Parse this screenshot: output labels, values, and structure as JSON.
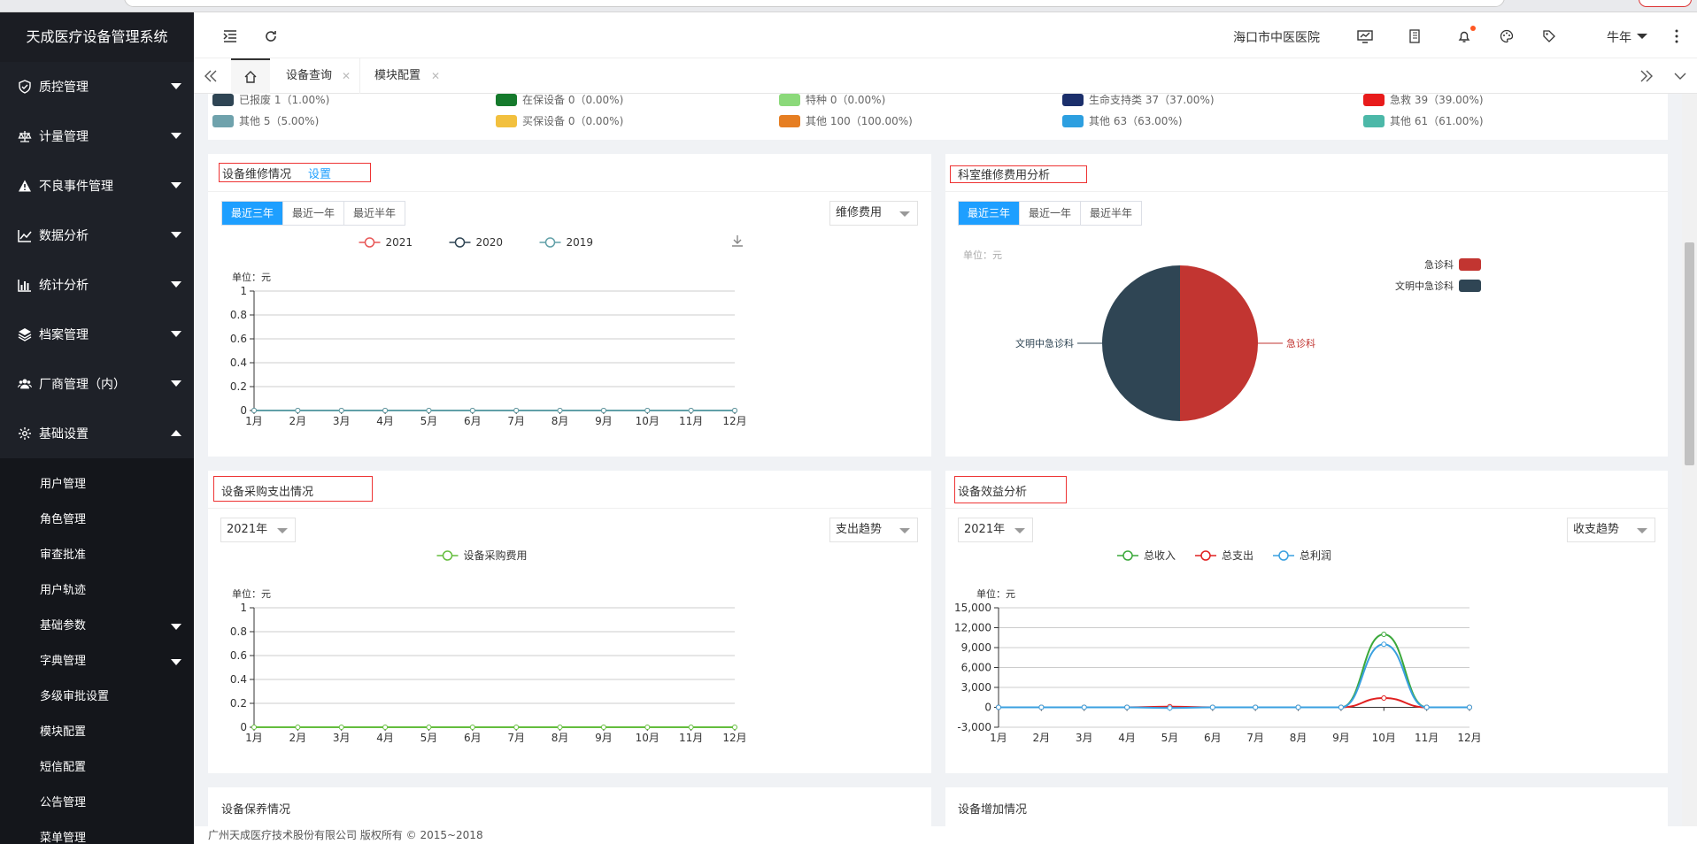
{
  "app": {
    "title": "天成医疗设备管理系统"
  },
  "sidebar": {
    "items": [
      {
        "label": "质控管理",
        "icon": "shield-check-icon"
      },
      {
        "label": "计量管理",
        "icon": "scale-icon"
      },
      {
        "label": "不良事件管理",
        "icon": "warning-icon"
      },
      {
        "label": "数据分析",
        "icon": "line-chart-icon"
      },
      {
        "label": "统计分析",
        "icon": "bar-chart-icon"
      },
      {
        "label": "档案管理",
        "icon": "layers-icon"
      },
      {
        "label": "厂商管理（内）",
        "icon": "users-icon"
      },
      {
        "label": "基础设置",
        "icon": "gear-icon"
      }
    ],
    "subitems": [
      "用户管理",
      "角色管理",
      "审查批准",
      "用户轨迹",
      "基础参数",
      "字典管理",
      "多级审批设置",
      "模块配置",
      "短信配置",
      "公告管理",
      "菜单管理"
    ]
  },
  "header": {
    "hospital": "海口市中医医院",
    "user": "牛年"
  },
  "tabs": {
    "items": [
      "设备查询",
      "模块配置"
    ]
  },
  "legend_strip": {
    "row1": [
      {
        "label": "已报废 1（1.00%)",
        "color": "#2f4554"
      },
      {
        "label": "在保设备 0（0.00%)",
        "color": "#157a2c"
      },
      {
        "label": "特种 0（0.00%)",
        "color": "#8bd97a"
      },
      {
        "label": "生命支持类 37（37.00%)",
        "color": "#1b2f6b"
      },
      {
        "label": "急救 39（39.00%)",
        "color": "#e81b1b"
      }
    ],
    "row2": [
      {
        "label": "其他 5（5.00%)",
        "color": "#6fa2ac"
      },
      {
        "label": "买保设备 0（0.00%)",
        "color": "#f2c03e"
      },
      {
        "label": "其他 100（100.00%)",
        "color": "#e67e22"
      },
      {
        "label": "其他 63（63.00%)",
        "color": "#2d9fe0"
      },
      {
        "label": "其他 61（61.00%)",
        "color": "#4cb8a8"
      }
    ]
  },
  "repair": {
    "title": "设备维修情况",
    "link": "设置",
    "segments": [
      "最近三年",
      "最近一年",
      "最近半年"
    ],
    "select": "维修费用",
    "unit": "单位：元"
  },
  "dept": {
    "title": "科室维修费用分析",
    "segments": [
      "最近三年",
      "最近一年",
      "最近半年"
    ],
    "unit": "单位：元"
  },
  "purchase": {
    "title": "设备采购支出情况",
    "year": "2021年",
    "select": "支出趋势",
    "unit": "单位：元"
  },
  "benefit": {
    "title": "设备效益分析",
    "year": "2021年",
    "select": "收支趋势",
    "unit": "单位：元"
  },
  "bottom": {
    "left_title": "设备保养情况",
    "right_title": "设备增加情况"
  },
  "footer": {
    "text": "广州天成医疗技术股份有限公司 版权所有 © 2015~2018"
  },
  "chart_data": [
    {
      "type": "line",
      "categories": [
        "1月",
        "2月",
        "3月",
        "4月",
        "5月",
        "6月",
        "7月",
        "8月",
        "9月",
        "10月",
        "11月",
        "12月"
      ],
      "series": [
        {
          "name": "2021",
          "color": "#e85656",
          "values": [
            0,
            0,
            0,
            0,
            0,
            0,
            0,
            0,
            0,
            0,
            0,
            0
          ]
        },
        {
          "name": "2020",
          "color": "#2f4554",
          "values": [
            0,
            0,
            0,
            0,
            0,
            0,
            0,
            0,
            0,
            0,
            0,
            0
          ]
        },
        {
          "name": "2019",
          "color": "#61a0a8",
          "values": [
            0,
            0,
            0,
            0,
            0,
            0,
            0,
            0,
            0,
            0,
            0,
            0
          ]
        }
      ],
      "ylim": [
        0,
        1
      ],
      "yticks": [
        "0",
        "0.2",
        "0.4",
        "0.6",
        "0.8",
        "1"
      ],
      "grid": true
    },
    {
      "type": "pie",
      "slices": [
        {
          "name": "急诊科",
          "value": 50,
          "color": "#c23531"
        },
        {
          "name": "文明中急诊科",
          "value": 50,
          "color": "#2f4554"
        }
      ],
      "legend": "top-right"
    },
    {
      "type": "line",
      "categories": [
        "1月",
        "2月",
        "3月",
        "4月",
        "5月",
        "6月",
        "7月",
        "8月",
        "9月",
        "10月",
        "11月",
        "12月"
      ],
      "series": [
        {
          "name": "设备采购费用",
          "color": "#64bd3d",
          "values": [
            0,
            0,
            0,
            0,
            0,
            0,
            0,
            0,
            0,
            0,
            0,
            0
          ]
        }
      ],
      "ylim": [
        0,
        1
      ],
      "yticks": [
        "0",
        "0.2",
        "0.4",
        "0.6",
        "0.8",
        "1"
      ],
      "grid": true
    },
    {
      "type": "line",
      "categories": [
        "1月",
        "2月",
        "3月",
        "4月",
        "5月",
        "6月",
        "7月",
        "8月",
        "9月",
        "10月",
        "11月",
        "12月"
      ],
      "series": [
        {
          "name": "总收入",
          "color": "#3aa83a",
          "values": [
            0,
            0,
            0,
            0,
            0,
            0,
            0,
            0,
            0,
            11000,
            0,
            0
          ]
        },
        {
          "name": "总支出",
          "color": "#e02020",
          "values": [
            0,
            0,
            0,
            0,
            100,
            0,
            0,
            0,
            0,
            1400,
            0,
            0
          ]
        },
        {
          "name": "总利润",
          "color": "#3aa0e0",
          "values": [
            0,
            0,
            0,
            0,
            -100,
            0,
            0,
            0,
            0,
            9500,
            0,
            0
          ]
        }
      ],
      "ylim": [
        -3000,
        15000
      ],
      "yticks": [
        "-3,000",
        "0",
        "3,000",
        "6,000",
        "9,000",
        "12,000",
        "15,000"
      ],
      "grid": true
    }
  ]
}
